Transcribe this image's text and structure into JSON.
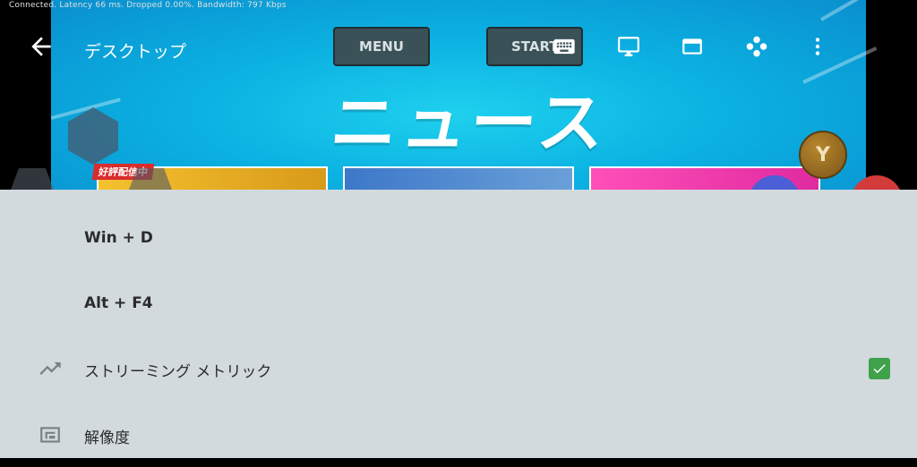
{
  "status_bar": {
    "text": "Connected. Latency 66 ms. Dropped 0.00%. Bandwidth: 797 Kbps"
  },
  "app_bar": {
    "title": "デスクトップ",
    "icons": [
      "back-arrow-icon",
      "keyboard-icon",
      "monitor-icon",
      "window-icon",
      "gamepad-buttons-icon",
      "more-vert-icon"
    ]
  },
  "game_overlay": {
    "news_title": "ニュース",
    "card_badge": "好評配信中",
    "menu_label": "MENU",
    "start_label": "START",
    "y_label": "Y"
  },
  "menu": {
    "items": [
      {
        "label": "Win + D",
        "icon": ""
      },
      {
        "label": "Alt + F4",
        "icon": ""
      },
      {
        "label": "ストリーミング メトリック",
        "icon": "trending-up-icon",
        "checked": true
      },
      {
        "label": "解像度",
        "icon": "resolution-icon"
      }
    ]
  },
  "colors": {
    "sheet_background": "#d2dade",
    "checkbox_checked": "#3fa24a",
    "game_button": "#3b5158"
  }
}
